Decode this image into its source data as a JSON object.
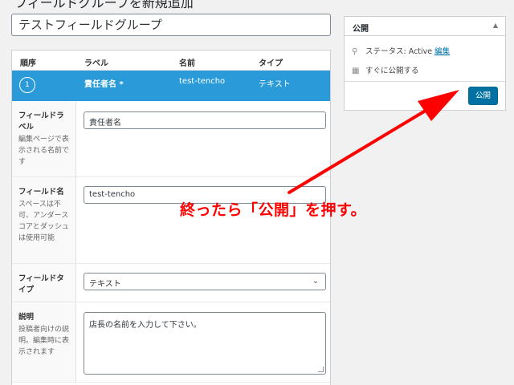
{
  "page": {
    "heading": "フィールドグループを新規追加",
    "title_value": "テストフィールドグループ"
  },
  "fields_table": {
    "headers": {
      "order": "順序",
      "label": "ラベル",
      "name": "名前",
      "type": "タイプ"
    },
    "selected_row": {
      "order": "1",
      "label": "責任者名 *",
      "name": "test-tencho",
      "type": "テキスト"
    }
  },
  "settings": {
    "field_label": {
      "label": "フィールドラベル",
      "desc": "編集ページで表示される名前です",
      "value": "責任者名"
    },
    "field_name": {
      "label": "フィールド名",
      "desc": "スペースは不可、アンダースコアとダッシュは使用可能",
      "value": "test-tencho"
    },
    "field_type": {
      "label": "フィールドタイプ",
      "value": "テキスト"
    },
    "description": {
      "label": "説明",
      "desc": "投稿者向けの説明。編集時に表示されます",
      "value": "店長の名前を入力して下さい。"
    }
  },
  "publish": {
    "title": "公開",
    "status_label": "ステータス: Active",
    "edit_link": "編集",
    "schedule": "すぐに公開する",
    "button": "公開"
  },
  "annotation": {
    "text": "終ったら「公開」を押す。",
    "color": "#ff0000"
  },
  "colors": {
    "selected_row": "#2a9bd8",
    "primary_button": "#0071a1",
    "link": "#0073aa"
  }
}
